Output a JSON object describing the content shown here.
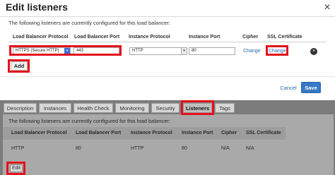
{
  "modal": {
    "title": "Edit listeners",
    "close_glyph": "×",
    "description": "The following listeners are currently configured for this load balancer:",
    "columns": [
      "Load Balancer Protocol",
      "Load Balancer Port",
      "Instance Protocol",
      "Instance Port",
      "Cipher",
      "SSL Certificate"
    ],
    "row": {
      "lb_protocol": "HTTPS (Secure HTTP)",
      "lb_port": "443",
      "instance_protocol": "HTTP",
      "instance_port": "80",
      "cipher_link": "Change",
      "ssl_link": "Change",
      "remove_glyph": "×"
    },
    "add_label": "Add",
    "cancel_label": "Cancel",
    "save_label": "Save"
  },
  "tabs": [
    "Description",
    "Instances",
    "Health Check",
    "Monitoring",
    "Security",
    "Listeners",
    "Tags"
  ],
  "active_tab": "Listeners",
  "panel": {
    "description": "The following listeners are currently configured for this load balancer:",
    "columns": [
      "Load Balancer Protocol",
      "Load Balancer Port",
      "Instance Protocol",
      "Instance Port",
      "Cipher",
      "SSL Certificate"
    ],
    "row": [
      "HTTP",
      "80",
      "HTTP",
      "80",
      "N/A",
      "N/A"
    ],
    "edit_label": "Edit"
  },
  "colors": {
    "highlight": "#e4121b",
    "link": "#2a67b1",
    "save_button": "#3578c6",
    "overlay": "#7c7c7c"
  }
}
